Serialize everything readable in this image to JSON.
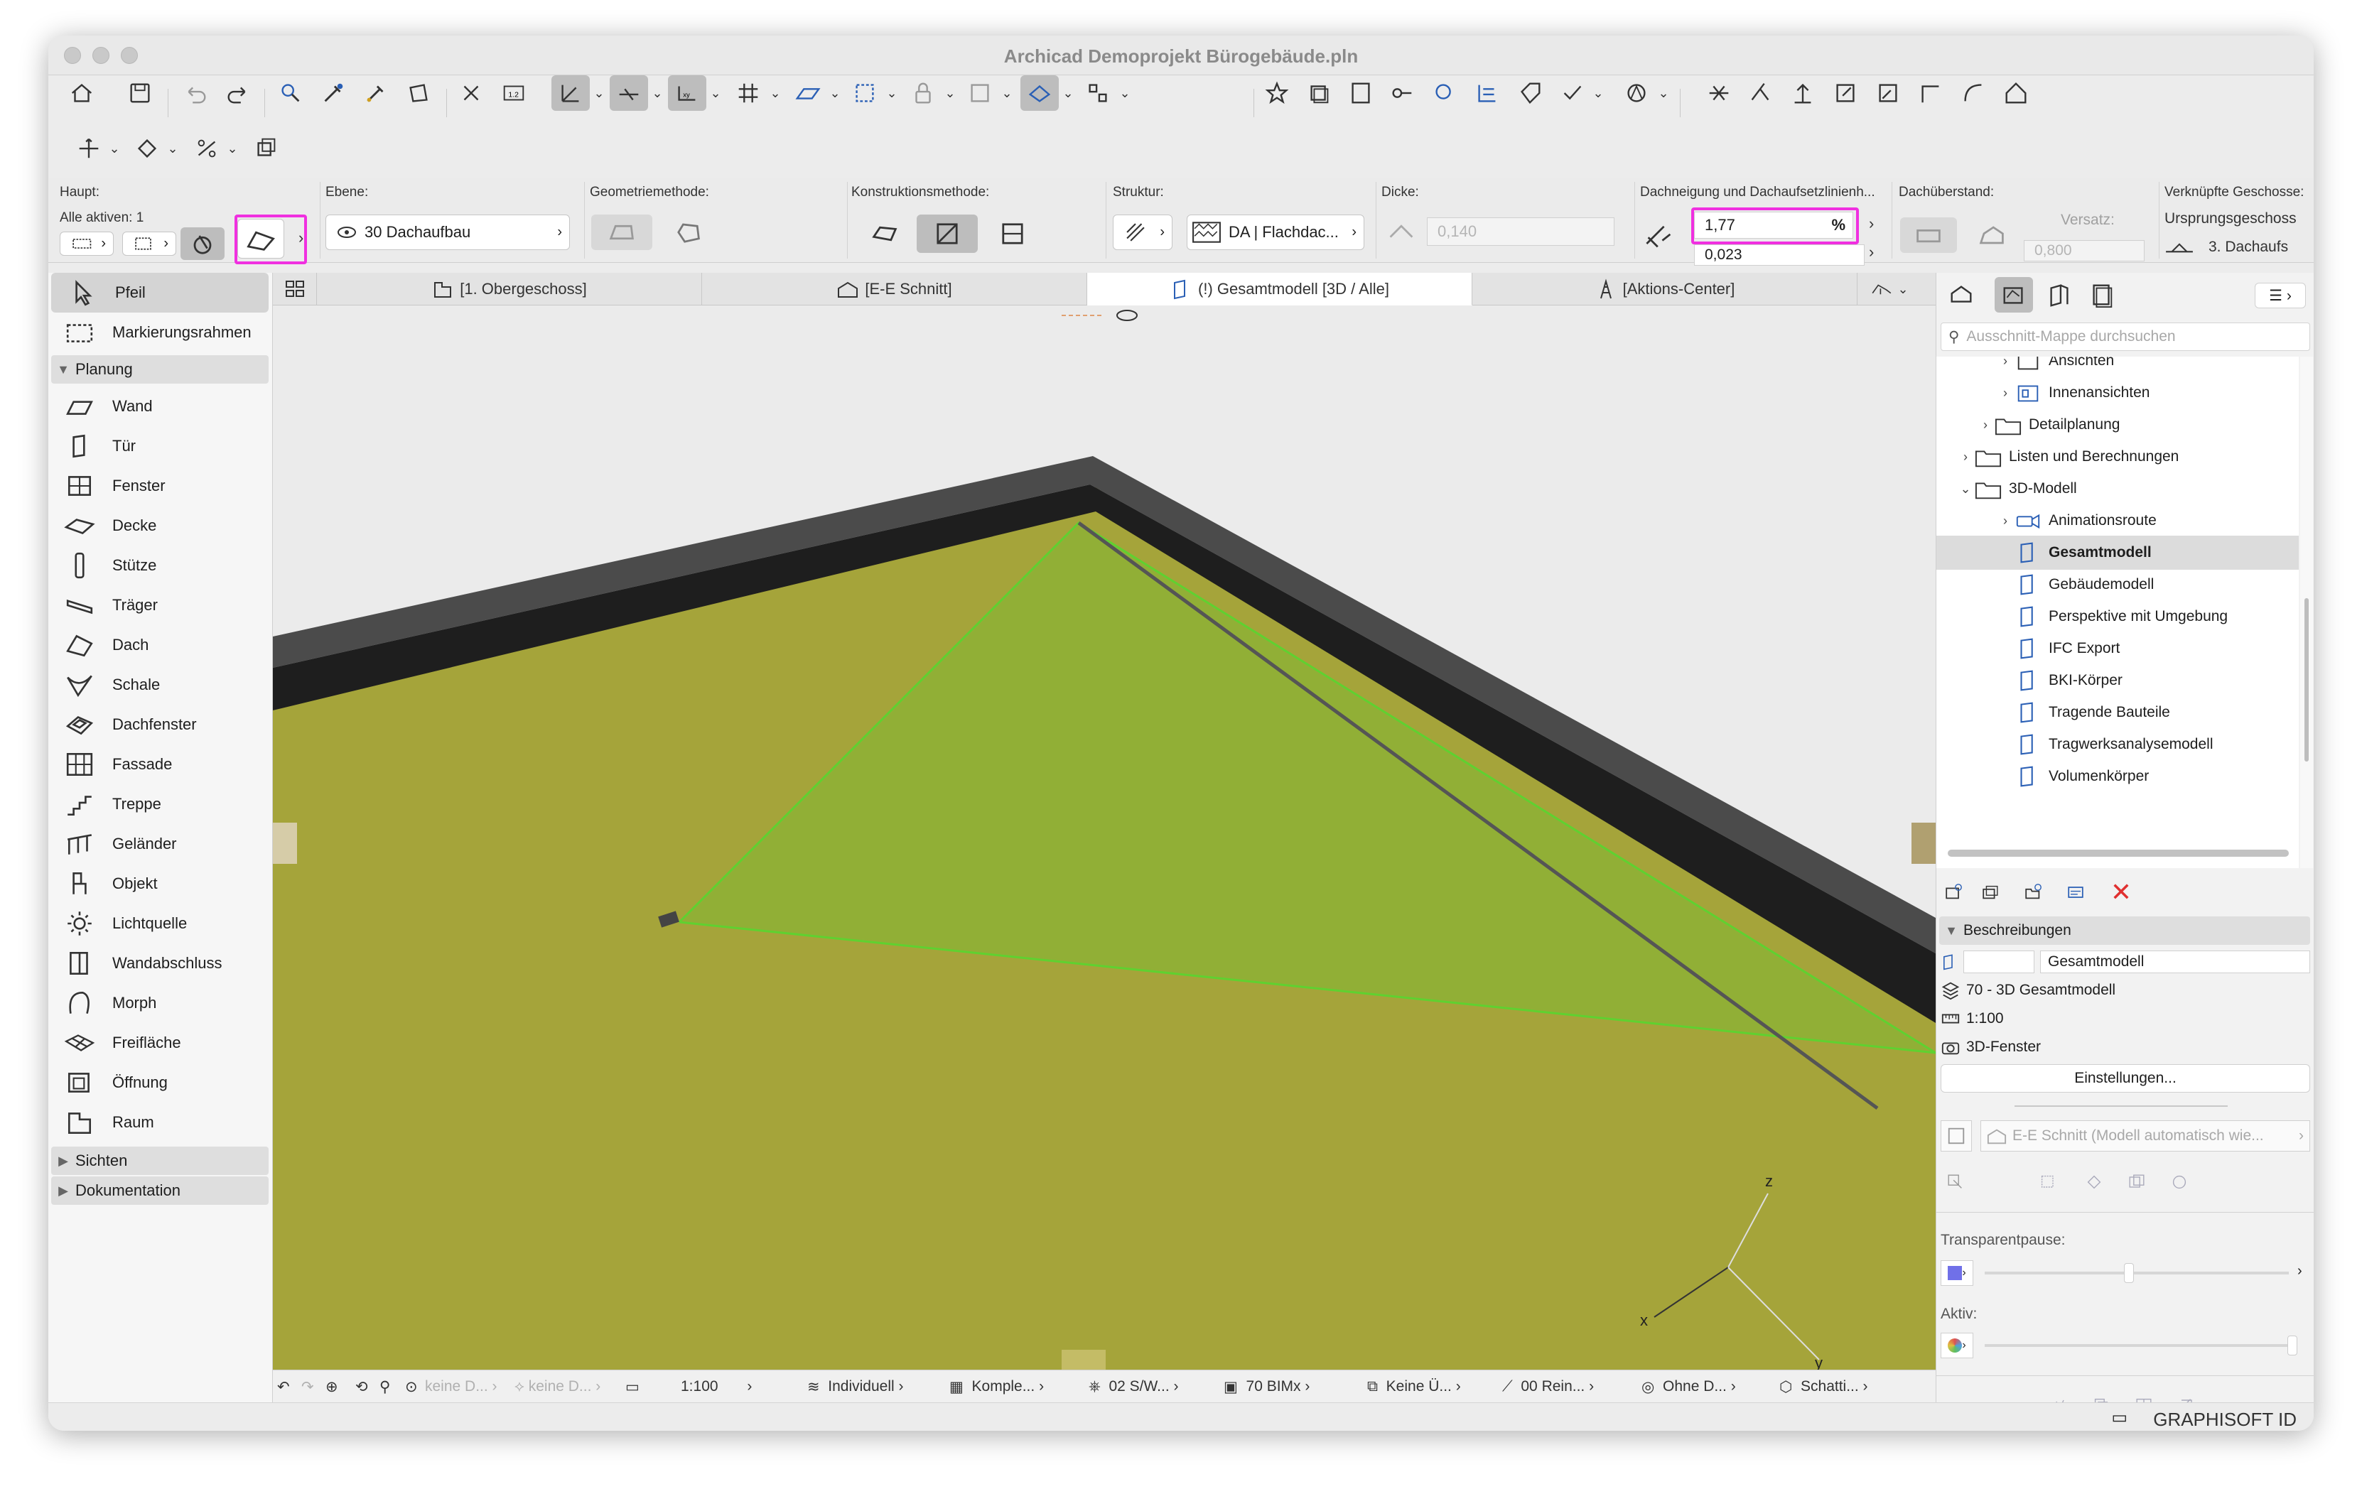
{
  "window": {
    "title": "Archicad Demoprojekt Bürogebäude.pln"
  },
  "infobox": {
    "haupt_label": "Haupt:",
    "alle_aktiven": "Alle aktiven: 1",
    "ebene_label": "Ebene:",
    "ebene_value": "30 Dachaufbau",
    "geometrie_label": "Geometriemethode:",
    "konstruktion_label": "Konstruktionsmethode:",
    "struktur_label": "Struktur:",
    "struktur_value": "DA | Flachdac...",
    "dicke_label": "Dicke:",
    "dicke_value": "0,140",
    "dachneigung_label": "Dachneigung und Dachaufsetzlinienh...",
    "dachneigung_value": "1,77",
    "dachneigung_unit": "%",
    "dachaufsetz_value": "0,023",
    "dachueberstand_label": "Dachüberstand:",
    "versatz_label": "Versatz:",
    "versatz_value": "0,800",
    "verknuepfte_label": "Verknüpfte Geschosse:",
    "ursprung_value": "Ursprungsgeschoss",
    "dachaufs_value": "3. Dachaufs"
  },
  "toolbox": {
    "tools_top": [
      {
        "label": "Pfeil",
        "icon": "arrow-icon"
      },
      {
        "label": "Markierungsrahmen",
        "icon": "marquee-icon"
      }
    ],
    "group_planung": "Planung",
    "planung": [
      {
        "label": "Wand",
        "icon": "wall-icon"
      },
      {
        "label": "Tür",
        "icon": "door-icon"
      },
      {
        "label": "Fenster",
        "icon": "window-icon"
      },
      {
        "label": "Decke",
        "icon": "slab-icon"
      },
      {
        "label": "Stütze",
        "icon": "column-icon"
      },
      {
        "label": "Träger",
        "icon": "beam-icon"
      },
      {
        "label": "Dach",
        "icon": "roof-icon"
      },
      {
        "label": "Schale",
        "icon": "shell-icon"
      },
      {
        "label": "Dachfenster",
        "icon": "skylight-icon"
      },
      {
        "label": "Fassade",
        "icon": "curtain-wall-icon"
      },
      {
        "label": "Treppe",
        "icon": "stair-icon"
      },
      {
        "label": "Geländer",
        "icon": "railing-icon"
      },
      {
        "label": "Objekt",
        "icon": "object-icon"
      },
      {
        "label": "Lichtquelle",
        "icon": "lamp-icon"
      },
      {
        "label": "Wandabschluss",
        "icon": "wall-end-icon"
      },
      {
        "label": "Morph",
        "icon": "morph-icon"
      },
      {
        "label": "Freifläche",
        "icon": "mesh-icon"
      },
      {
        "label": "Öffnung",
        "icon": "opening-icon"
      },
      {
        "label": "Raum",
        "icon": "zone-icon"
      }
    ],
    "group_sichten": "Sichten",
    "group_dokumentation": "Dokumentation"
  },
  "tabs": [
    {
      "label": "[1. Obergeschoss]",
      "icon": "floorplan-icon"
    },
    {
      "label": "[E-E Schnitt]",
      "icon": "section-icon"
    },
    {
      "label": "(!) Gesamtmodell [3D / Alle]",
      "icon": "3d-icon"
    },
    {
      "label": "[Aktions-Center]",
      "icon": "action-center-icon"
    }
  ],
  "viewport": {
    "axis_x": "x",
    "axis_y": "y",
    "axis_z": "z",
    "colors": {
      "slab": "#a5a43a",
      "roof": "#8fb036",
      "parapet": "#4b4b4b",
      "highlight": "#5fd130"
    }
  },
  "status": [
    {
      "label": "keine D...",
      "dim": true
    },
    {
      "label": "keine D...",
      "dim": true
    },
    {
      "label": "1:100"
    },
    {
      "label": "Individuell"
    },
    {
      "label": "Komple..."
    },
    {
      "label": "02 S/W..."
    },
    {
      "label": "70 BIMx"
    },
    {
      "label": "Keine Ü..."
    },
    {
      "label": "00 Rein..."
    },
    {
      "label": "Ohne D..."
    },
    {
      "label": "Schatti..."
    }
  ],
  "navigator": {
    "search_placeholder": "Ausschnitt-Mappe durchsuchen",
    "tree": [
      {
        "label": "Ansichten",
        "indent": 3,
        "chev": "›",
        "icon": "elevation-icon"
      },
      {
        "label": "Innenansichten",
        "indent": 3,
        "chev": "›",
        "icon": "interior-elevation-icon"
      },
      {
        "label": "Detailplanung",
        "indent": 2,
        "chev": "›",
        "icon": "folder-icon"
      },
      {
        "label": "Listen und Berechnungen",
        "indent": 1,
        "chev": "›",
        "icon": "folder-icon"
      },
      {
        "label": "3D-Modell",
        "indent": 1,
        "chev": "⌄",
        "icon": "folder-icon"
      },
      {
        "label": "Animationsroute",
        "indent": 3,
        "chev": "›",
        "icon": "camera-path-icon"
      },
      {
        "label": "Gesamtmodell",
        "indent": 3,
        "chev": "",
        "icon": "3d-view-icon",
        "selected": true
      },
      {
        "label": "Gebäudemodell",
        "indent": 3,
        "chev": "",
        "icon": "3d-view-icon"
      },
      {
        "label": "Perspektive mit Umgebung",
        "indent": 3,
        "chev": "",
        "icon": "3d-view-icon"
      },
      {
        "label": "IFC Export",
        "indent": 3,
        "chev": "",
        "icon": "3d-view-icon"
      },
      {
        "label": "BKI-Körper",
        "indent": 3,
        "chev": "",
        "icon": "3d-view-icon"
      },
      {
        "label": "Tragende Bauteile",
        "indent": 3,
        "chev": "",
        "icon": "3d-view-icon"
      },
      {
        "label": "Tragwerksanalysemodell",
        "indent": 3,
        "chev": "",
        "icon": "3d-view-icon"
      },
      {
        "label": "Volumenkörper",
        "indent": 3,
        "chev": "",
        "icon": "3d-view-icon"
      }
    ],
    "section_beschreibungen": "Beschreibungen",
    "view_name": "Gesamtmodell",
    "view_id": "70 - 3D Gesamtmodell",
    "scale": "1:100",
    "window_type": "3D-Fenster",
    "settings_button": "Einstellungen...",
    "source_view": "E-E Schnitt (Modell automatisch wie...",
    "transparent_label": "Transparentpause:",
    "aktiv_label": "Aktiv:"
  },
  "footer": {
    "graphisoft_id": "GRAPHISOFT ID"
  }
}
